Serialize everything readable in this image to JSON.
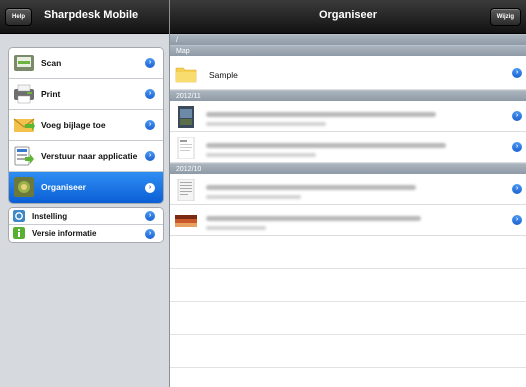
{
  "left": {
    "help_label": "Help",
    "title": "Sharpdesk Mobile",
    "menu": [
      {
        "label": "Scan",
        "icon": "scan-icon",
        "selected": false
      },
      {
        "label": "Print",
        "icon": "print-icon",
        "selected": false
      },
      {
        "label": "Voeg bijlage toe",
        "icon": "attach-icon",
        "selected": false
      },
      {
        "label": "Verstuur naar applicatie",
        "icon": "send-to-app-icon",
        "selected": false
      },
      {
        "label": "Organiseer",
        "icon": "organize-icon",
        "selected": true
      }
    ],
    "settings": [
      {
        "label": "Instelling",
        "icon": "settings-icon"
      },
      {
        "label": "Versie informatie",
        "icon": "info-icon"
      }
    ]
  },
  "right": {
    "title": "Organiseer",
    "edit_label": "Wijzig",
    "path": "/",
    "sections": [
      {
        "header": "Map",
        "rows": [
          {
            "name": "Sample",
            "type": "folder"
          }
        ]
      },
      {
        "header": "2012/11",
        "rows": [
          {
            "name": "",
            "type": "photo"
          },
          {
            "name": "",
            "type": "document"
          }
        ]
      },
      {
        "header": "2012/10",
        "rows": [
          {
            "name": "",
            "type": "document"
          },
          {
            "name": "",
            "type": "photo"
          }
        ]
      }
    ]
  },
  "colors": {
    "selection_blue": "#1a6fe0",
    "disclosure_blue": "#2b78e4",
    "section_header": "#9ca7b2",
    "sidebar_bg": "#d6d9de"
  }
}
